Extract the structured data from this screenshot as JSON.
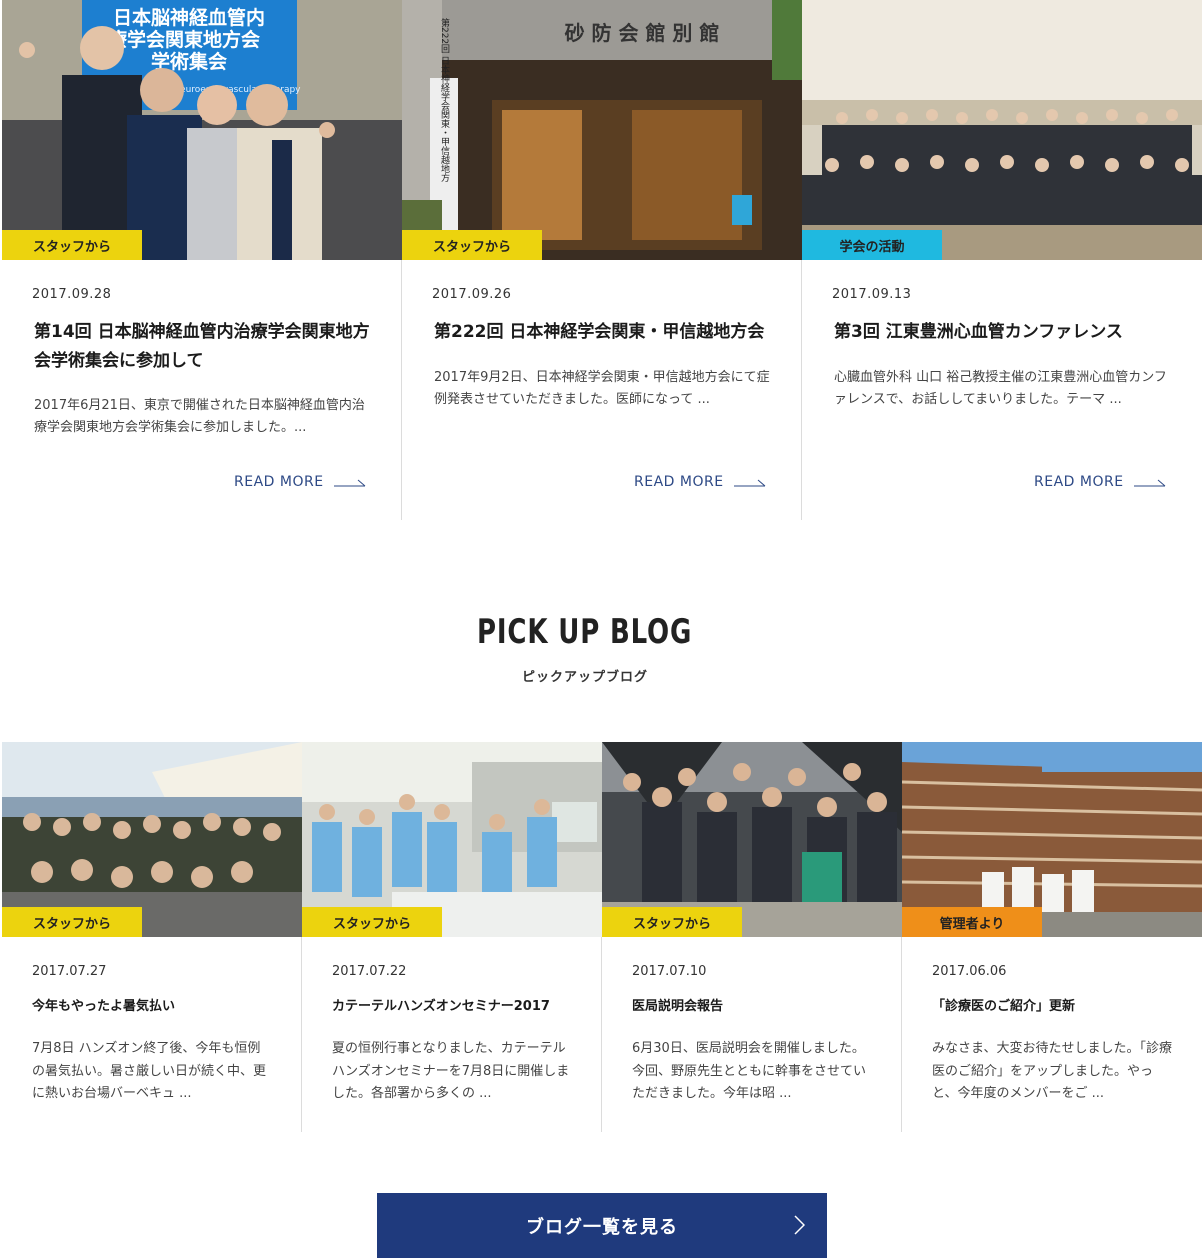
{
  "colors": {
    "staff_badge": "#ecd30e",
    "society_badge": "#1fb9e0",
    "admin_badge": "#ef8f19",
    "accent_navy": "#1f3a7d",
    "link_blue": "#2e4a86"
  },
  "top_cards": [
    {
      "badge": "スタッフから",
      "date": "2017.09.28",
      "title": "第14回 日本脳神経血管内治療学会関東地方会学術集会に参加して",
      "excerpt": "2017年6月21日、東京で開催された日本脳神経血管内治療学会関東地方会学術集会に参加しました。...",
      "read_more": "READ MORE",
      "image_sign_lines": [
        "日本脳神経血管内",
        "療学会関東地方会",
        "学術集会"
      ],
      "image_sign_small": "The 14th ... for Neuroendovascular Therapy"
    },
    {
      "badge": "スタッフから",
      "date": "2017.09.26",
      "title": "第222回 日本神経学会関東・甲信越地方会",
      "excerpt": "2017年9月2日、日本神経学会関東・甲信越地方会にて症例発表させていただきました。医師になって ...",
      "read_more": "READ MORE",
      "image_sign": "砂 防 会 館 別 館",
      "image_banner": "第222回 日本神経学会関東・甲信越地方"
    },
    {
      "badge": "学会の活動",
      "date": "2017.09.13",
      "title": "第3回 江東豊洲心血管カンファレンス",
      "excerpt": "心臓血管外科 山口 裕己教授主催の江東豊洲心血管カンファレンスで、お話ししてまいりました。テーマ ...",
      "read_more": "READ MORE"
    }
  ],
  "pickup": {
    "title": "PICK UP BLOG",
    "subtitle": "ピックアップブログ"
  },
  "blog_cards": [
    {
      "badge": "スタッフから",
      "date": "2017.07.27",
      "title": "今年もやったよ暑気払い",
      "excerpt": "7月8日 ハンズオン終了後、今年も恒例の暑気払い。暑さ厳しい日が続く中、更に熱いお台場バーベキュ ..."
    },
    {
      "badge": "スタッフから",
      "date": "2017.07.22",
      "title": "カテーテルハンズオンセミナー2017",
      "excerpt": "夏の恒例行事となりました、カテーテルハンズオンセミナーを7月8日に開催しました。各部署から多くの ..."
    },
    {
      "badge": "スタッフから",
      "date": "2017.07.10",
      "title": "医局説明会報告",
      "excerpt": "6月30日、医局説明会を開催しました。今回、野原先生とともに幹事をさせていただきました。今年は昭 ..."
    },
    {
      "badge": "管理者より",
      "date": "2017.06.06",
      "title": "「診療医のご紹介」更新",
      "excerpt": "みなさま、大変お待たせしました。「診療医のご紹介」をアップしました。やっと、今年度のメンバーをご ..."
    }
  ],
  "blog_list_button": "ブログ一覧を見る",
  "icons": [
    "arrow-right-icon",
    "chevron-right-icon"
  ]
}
